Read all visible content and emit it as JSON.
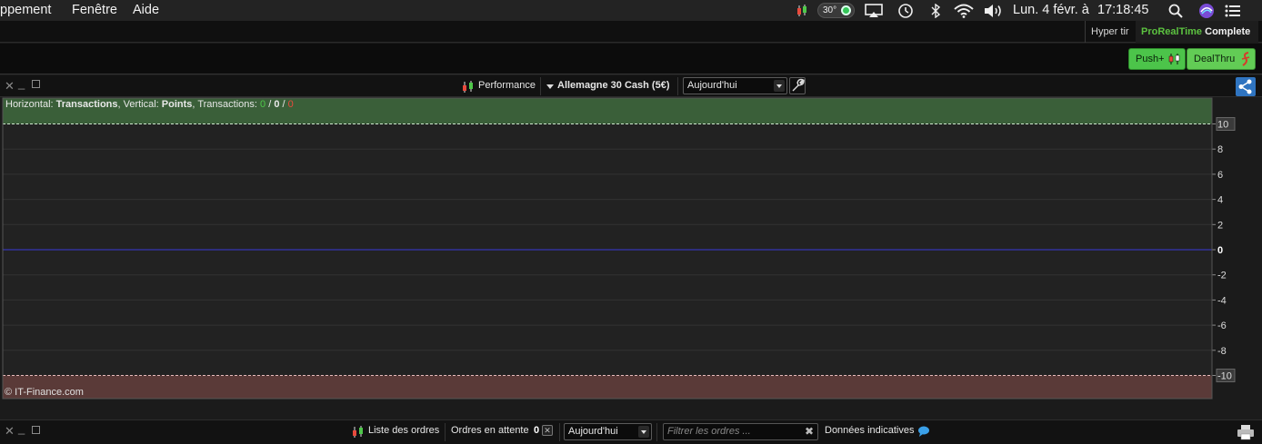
{
  "menubar": {
    "items": [
      "ppement",
      "Fenêtre",
      "Aide"
    ],
    "temperature": "30°",
    "datetime_day": "Lun. 4 févr. à",
    "datetime_time": "17:18:45"
  },
  "topbar": {
    "hyper_label": "Hyper tir",
    "prt_brand": "ProRealTime",
    "prt_edition": "Complete",
    "push_label": "Push+",
    "dealthru_label": "DealThru"
  },
  "performance_toolbar": {
    "title": "Performance",
    "instrument": "Allemagne 30 Cash (5€)",
    "period": "Aujourd'hui"
  },
  "chart_data": {
    "type": "line",
    "info": {
      "horizontal_prefix": "Horizontal: ",
      "horizontal_value": "Transactions",
      "vertical_prefix": ", Vertical: ",
      "vertical_value": "Points",
      "transactions_prefix": ", Transactions: ",
      "win": "0",
      "sep1": " / ",
      "neutral": "0",
      "sep2": " / ",
      "loss": "0"
    },
    "ylim": [
      -10,
      10
    ],
    "y_ticks": [
      "10",
      "8",
      "6",
      "4",
      "2",
      "0",
      "-2",
      "-4",
      "-6",
      "-8",
      "-10"
    ],
    "y_values": [
      10,
      8,
      6,
      4,
      2,
      0,
      -2,
      -4,
      -6,
      -8,
      -10
    ],
    "zero_line": 0,
    "upper_limit": 10,
    "lower_limit": -10,
    "series": [],
    "colors": {
      "positive_zone": "#3a5f39",
      "negative_zone": "#5a3a38",
      "zero_line": "#3a3ad8"
    },
    "copyright": "© IT-Finance.com"
  },
  "orders_bar": {
    "list_label": "Liste des ordres",
    "pending_label": "Ordres en attente",
    "pending_count": "0",
    "period": "Aujourd'hui",
    "filter_placeholder": "Filtrer les ordres ...",
    "indicative_label": "Données indicatives"
  }
}
